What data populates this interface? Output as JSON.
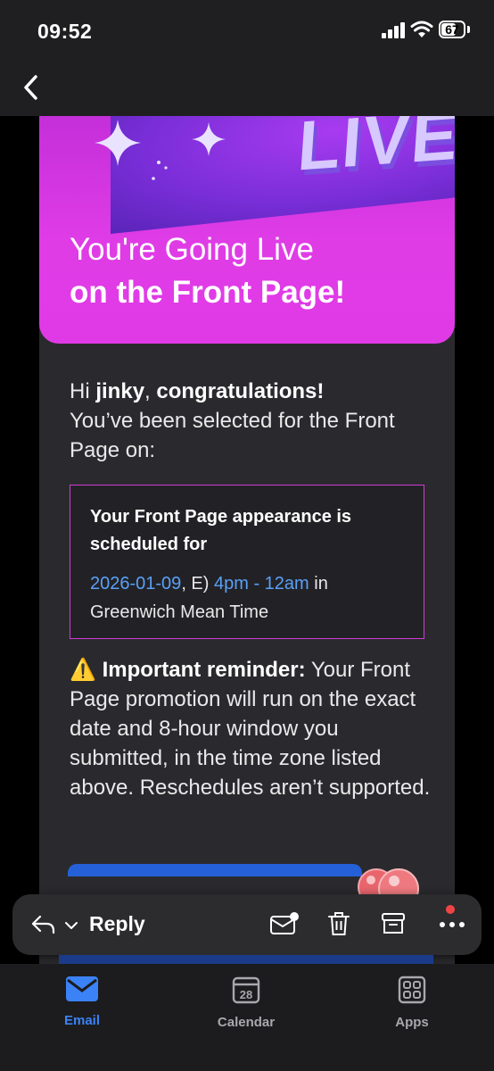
{
  "status_bar": {
    "time": "09:52",
    "battery_level": "67",
    "icons": [
      "signal-icon",
      "wifi-icon",
      "battery-icon"
    ]
  },
  "nav": {
    "back_icon": "chevron-left-icon"
  },
  "hero": {
    "graphic_text": "LIVE",
    "title_line1": "You're Going Live",
    "title_line2": "on the Front Page!"
  },
  "greeting": {
    "hi": "Hi ",
    "name": "jinky",
    "comma": ", ",
    "congrats": "congratulations!",
    "selected": "You’ve been selected for the Front Page on:"
  },
  "schedule": {
    "heading": "Your Front Page appearance is scheduled for",
    "date": "2026-01-09",
    "mid": ", E) ",
    "time_range": "4pm - 12am",
    "after": " in Greenwich Mean Time"
  },
  "reminder": {
    "emoji": "⚠️",
    "label": "Important reminder:",
    "text": " Your Front Page promotion will run on the exact date and 8-hour window you submitted, in the time zone listed above. Reschedules aren’t supported."
  },
  "reply_bar": {
    "reply_label": "Reply",
    "icons": [
      "reply-icon",
      "chevron-down-icon",
      "mark-unread-icon",
      "delete-icon",
      "archive-icon",
      "more-icon"
    ]
  },
  "tabs": [
    {
      "label": "Email",
      "icon": "email-icon",
      "active": true
    },
    {
      "label": "Calendar",
      "icon": "calendar-icon",
      "badge": "28",
      "active": false
    },
    {
      "label": "Apps",
      "icon": "apps-icon",
      "active": false
    }
  ],
  "colors": {
    "accent_blue": "#3b82f6",
    "hero_pink": "#e03ae6",
    "link_blue": "#5aa0f7",
    "alert_red": "#f04444"
  }
}
